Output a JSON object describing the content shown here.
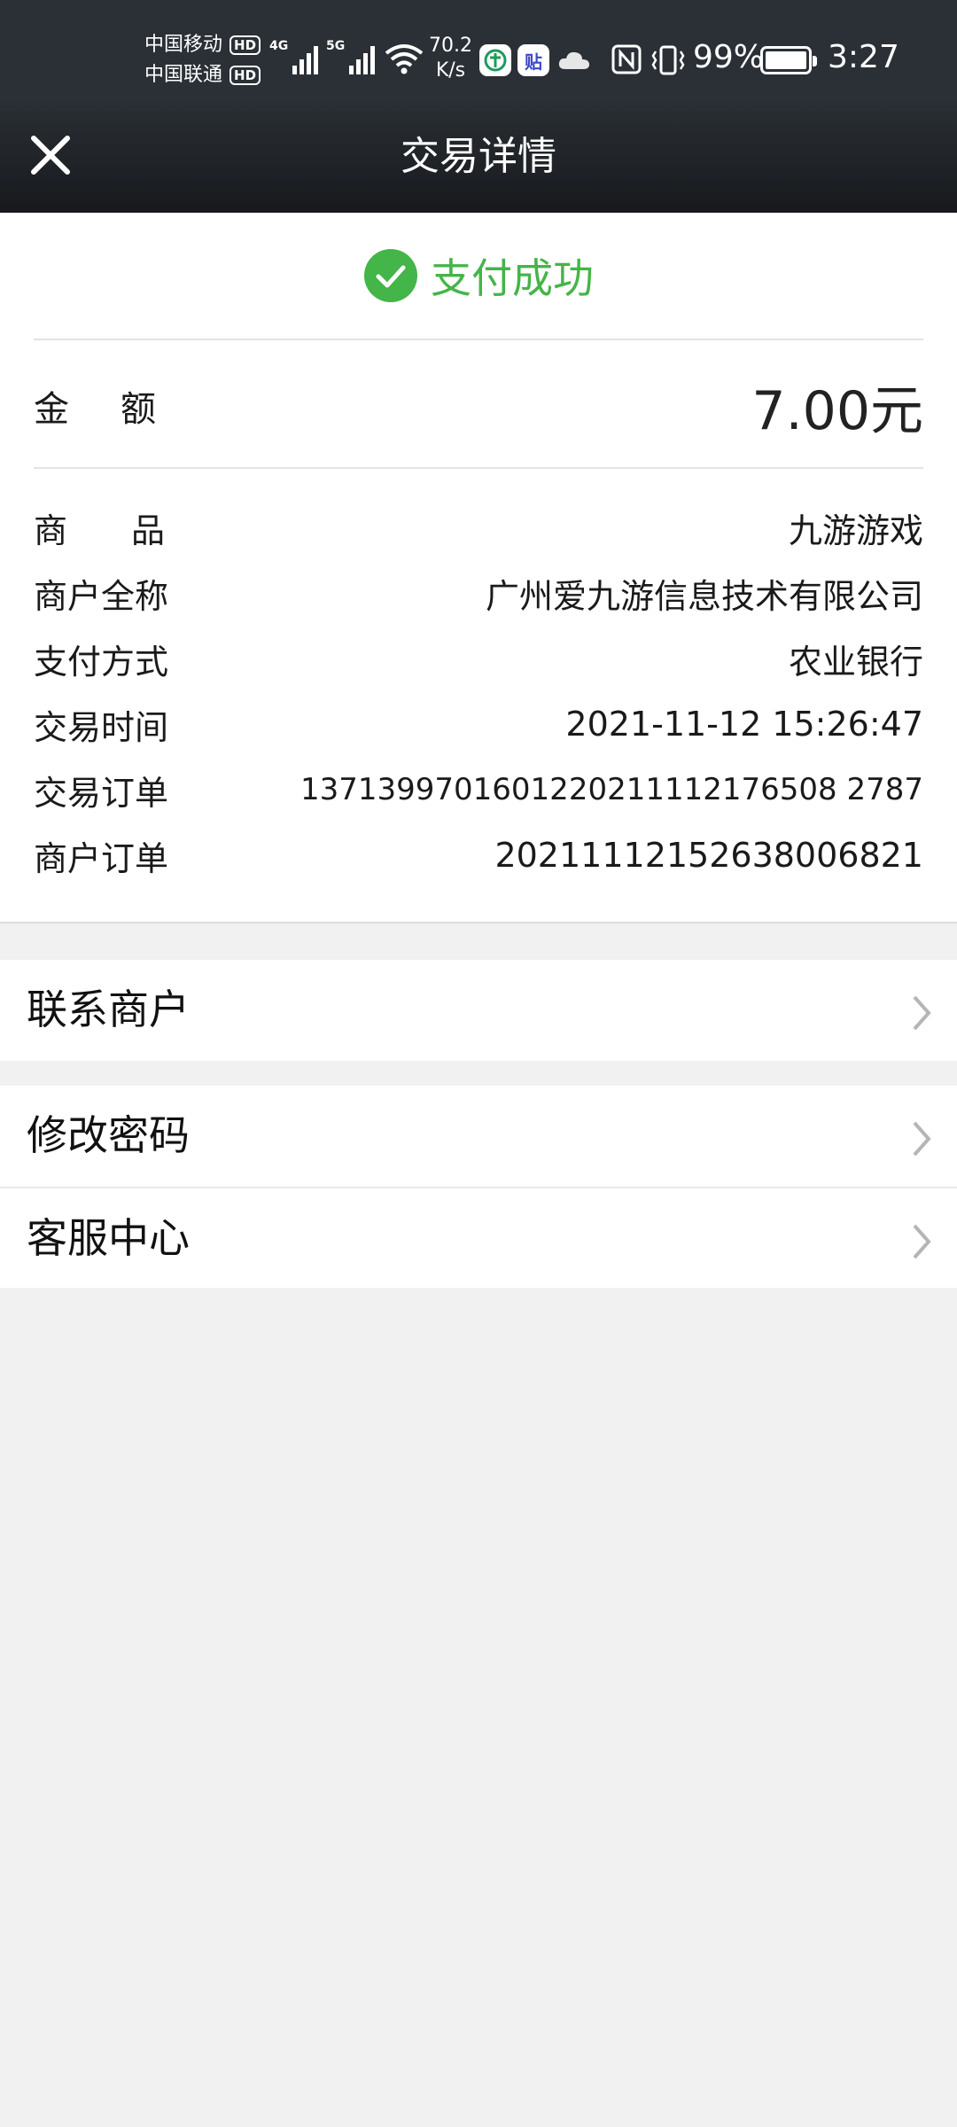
{
  "status_bar": {
    "carrier1": "中国移动",
    "carrier2": "中国联通",
    "hd_label": "HD",
    "net1_type": "4G",
    "net2_type": "5G",
    "net_speed_value": "70.2",
    "net_speed_unit": "K/s",
    "app_icon_tie": "贴",
    "battery_percent": "99%",
    "battery_level": 0.99,
    "time": "3:27"
  },
  "header": {
    "title": "交易详情"
  },
  "payment": {
    "status_text": "支付成功",
    "status_color": "#44b549",
    "amount_label": "金额",
    "amount_value": "7.00元"
  },
  "details": [
    {
      "label": "商品",
      "value": "九游游戏"
    },
    {
      "label": "商户全称",
      "value": "广州爱九游信息技术有限公司"
    },
    {
      "label": "支付方式",
      "value": "农业银行"
    },
    {
      "label": "交易时间",
      "value": "2021-11-12 15:26:47"
    },
    {
      "label": "交易订单",
      "value": "1371399701601220211112176508 2787"
    },
    {
      "label": "商户订单",
      "value": "20211112152638006821"
    }
  ],
  "menu": {
    "contact_merchant": "联系商户",
    "change_password": "修改密码",
    "customer_service": "客服中心"
  }
}
